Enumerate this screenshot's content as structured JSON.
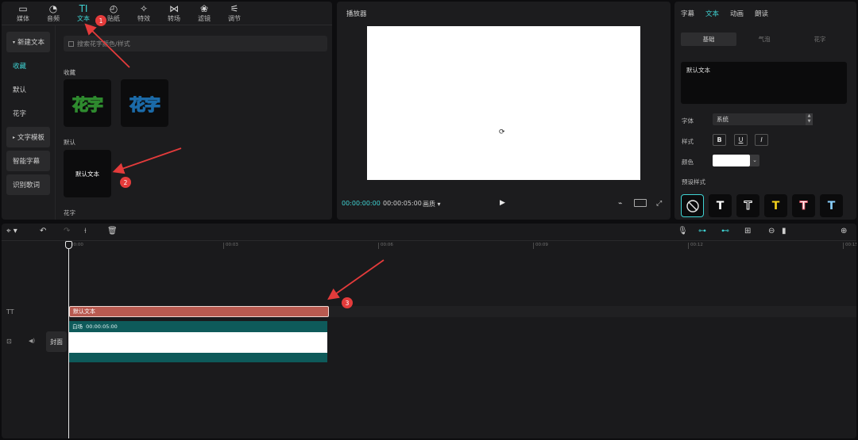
{
  "toolbar": {
    "items": [
      {
        "label": "媒体",
        "icon": "▭"
      },
      {
        "label": "音频",
        "icon": "◔"
      },
      {
        "label": "文本",
        "icon": "TI"
      },
      {
        "label": "贴纸",
        "icon": "◴"
      },
      {
        "label": "特效",
        "icon": "✧"
      },
      {
        "label": "转场",
        "icon": "⋈"
      },
      {
        "label": "滤镜",
        "icon": "❀"
      },
      {
        "label": "调节",
        "icon": "⚟"
      }
    ]
  },
  "sidebar": {
    "items": [
      {
        "label": "新建文本",
        "group": true
      },
      {
        "label": "收藏"
      },
      {
        "label": "默认"
      },
      {
        "label": "花字"
      },
      {
        "label": "文字模板",
        "group": true
      },
      {
        "label": "智能字幕",
        "group": true
      },
      {
        "label": "识别歌词",
        "group": true
      }
    ]
  },
  "content": {
    "search_placeholder": "搜索花字颜色/样式",
    "section_favorites": "收藏",
    "huazi_sample": "花字",
    "section_default": "默认",
    "default_tile_text": "默认文本",
    "section_huazi": "花字"
  },
  "player": {
    "title": "播放器",
    "current_time": "00:00:00:00",
    "total_time": "00:00:05:00",
    "ratio_label": "画质",
    "loader_icon": "⟳"
  },
  "props": {
    "tabs": [
      "字幕",
      "文本",
      "动画",
      "朗读"
    ],
    "subtabs": [
      "基础",
      "气泡",
      "花字"
    ],
    "text_value": "默认文本",
    "font_label": "字体",
    "font_value": "系统",
    "style_label": "样式",
    "style_buttons": [
      "B",
      "U",
      "I"
    ],
    "color_label": "颜色",
    "preset_label": "预设样式",
    "presets": [
      {
        "glyph": "⃠",
        "color": "#ffffff"
      },
      {
        "glyph": "T",
        "color": "#ffffff"
      },
      {
        "glyph": "T",
        "color": "#1c1c1e"
      },
      {
        "glyph": "T",
        "color": "#f4d21c"
      },
      {
        "glyph": "T",
        "color": "#ffffff"
      },
      {
        "glyph": "T",
        "color": "#8ad0ff"
      }
    ]
  },
  "timeline": {
    "ruler_ticks": [
      "00:00",
      "00:03",
      "00:06",
      "00:09",
      "00:12",
      "00:15"
    ],
    "text_clip_label": "默认文本",
    "video_clip_label": "白场",
    "video_clip_time": "00:00:05:00",
    "cover_label": "封面",
    "text_track_icon": "TT",
    "video_track_icon": "⊡",
    "audio_track_icon": "◀)"
  },
  "annotations": {
    "badges": [
      "1",
      "2",
      "3"
    ]
  },
  "colors": {
    "accent": "#3fd3d3",
    "annotation": "#e43b3b",
    "text_clip": "#b85a50",
    "video_clip": "#0e5a5a"
  }
}
